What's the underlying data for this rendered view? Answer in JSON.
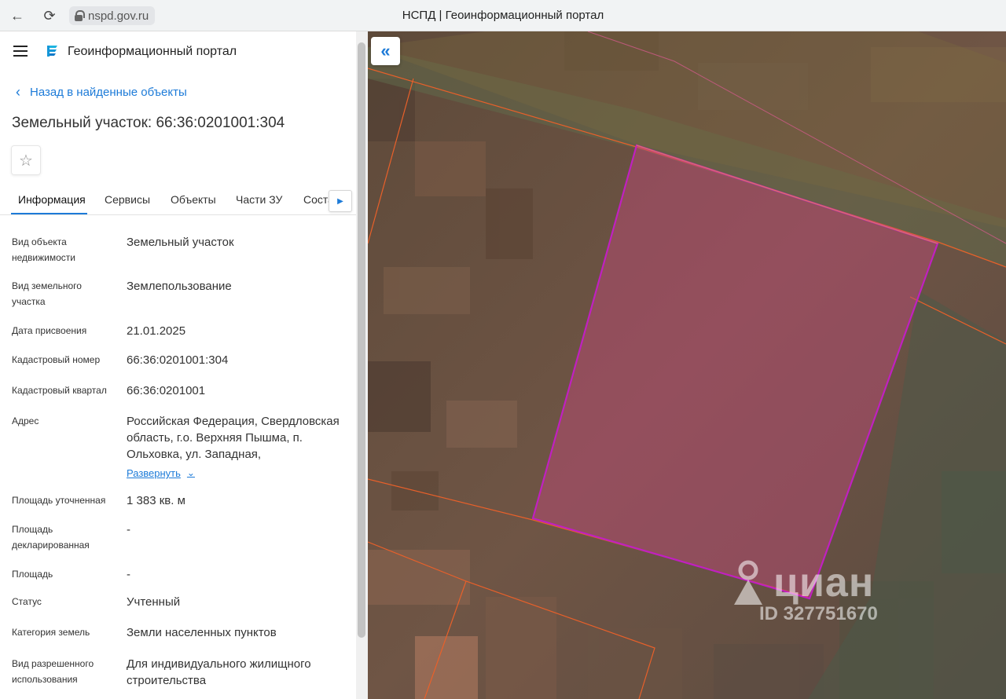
{
  "browser": {
    "url": "nspd.gov.ru",
    "tab_title": "НСПД | Геоинформационный портал"
  },
  "header": {
    "portal_title": "Геоинформационный портал"
  },
  "back_link": "Назад в найденные объекты",
  "page_title": "Земельный участок: 66:36:0201001:304",
  "tabs": [
    {
      "label": "Информация",
      "active": true
    },
    {
      "label": "Сервисы"
    },
    {
      "label": "Объекты"
    },
    {
      "label": "Части ЗУ"
    },
    {
      "label": "Состав"
    }
  ],
  "details": [
    {
      "label": "Вид объекта недвижимости",
      "value": "Земельный участок"
    },
    {
      "label": "Вид земельного участка",
      "value": "Землепользование"
    },
    {
      "label": "Дата присвоения",
      "value": "21.01.2025"
    },
    {
      "label": "Кадастровый номер",
      "value": "66:36:0201001:304"
    },
    {
      "label": "Кадастровый квартал",
      "value": "66:36:0201001"
    },
    {
      "label": "Адрес",
      "value": "Российская Федерация, Свердловская область, г.о. Верхняя Пышма, п. Ольховка, ул. Западная,"
    },
    {
      "label": "Площадь уточненная",
      "value": "1 383 кв. м"
    },
    {
      "label": "Площадь декларированная",
      "value": "-"
    },
    {
      "label": "Площадь",
      "value": "-"
    },
    {
      "label": "Статус",
      "value": "Учтенный"
    },
    {
      "label": "Категория земель",
      "value": "Земли населенных пунктов"
    },
    {
      "label": "Вид разрешенного использования",
      "value": "Для индивидуального жилищного строительства"
    }
  ],
  "expand_label": "Развернуть",
  "watermark": {
    "brand": "циан",
    "id": "ID 327751670"
  },
  "colors": {
    "accent": "#1d7bd8",
    "parcel_outline": "#c020c0",
    "boundary": "#e8602a"
  }
}
